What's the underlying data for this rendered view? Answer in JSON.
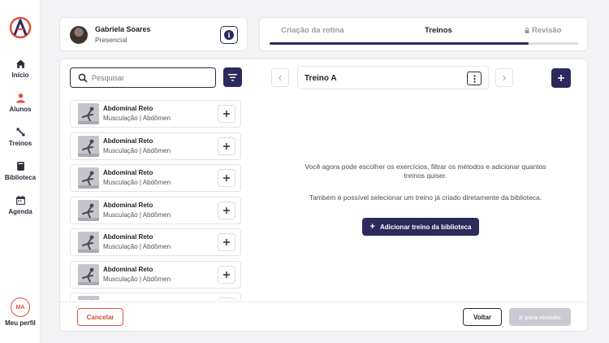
{
  "sidebar": {
    "items": [
      {
        "label": "Início",
        "icon": "home-icon"
      },
      {
        "label": "Alunos",
        "icon": "user-icon",
        "active": true
      },
      {
        "label": "Treinos",
        "icon": "expand-arrows-icon"
      },
      {
        "label": "Biblioteca",
        "icon": "book-icon"
      },
      {
        "label": "Agenda",
        "icon": "calendar-icon"
      }
    ],
    "profile": {
      "initials": "MA",
      "label": "Meu perfil"
    }
  },
  "student": {
    "name": "Gabriela Soares",
    "mode": "Presencial"
  },
  "steps": {
    "items": [
      {
        "label": "Criação da rotina"
      },
      {
        "label": "Treinos"
      },
      {
        "label": "Revisão",
        "locked": true
      }
    ],
    "progress": 0.84
  },
  "search": {
    "placeholder": "Pesquisar",
    "value": ""
  },
  "exercises": [
    {
      "name": "Abdominal Reto",
      "category": "Musculação | Abdômen"
    },
    {
      "name": "Abdominal Reto",
      "category": "Musculação | Abdômen"
    },
    {
      "name": "Abdominal Reto",
      "category": "Musculação | Abdômen"
    },
    {
      "name": "Abdominal Reto",
      "category": "Musculação | Abdômen"
    },
    {
      "name": "Abdominal Reto",
      "category": "Musculação | Abdômen"
    },
    {
      "name": "Abdominal Reto",
      "category": "Musculação | Abdômen"
    },
    {
      "name": "",
      "category": ""
    }
  ],
  "workout": {
    "title": "Treino A"
  },
  "empty_state": {
    "message_1": "Você agora pode escolher os exercícios, filtrar os métodos e adicionar quantos treinos quiser.",
    "message_2": "Também é possível selecionar um treino já criado diretamente da biblioteca.",
    "library_button": "Adicionar treino da biblioteca"
  },
  "footer": {
    "cancel": "Cancelar",
    "back": "Voltar",
    "review": "Ir para revisão"
  },
  "colors": {
    "primary": "#2c2a5c",
    "accent": "#e0503a",
    "disabled": "#c9c9d2"
  }
}
